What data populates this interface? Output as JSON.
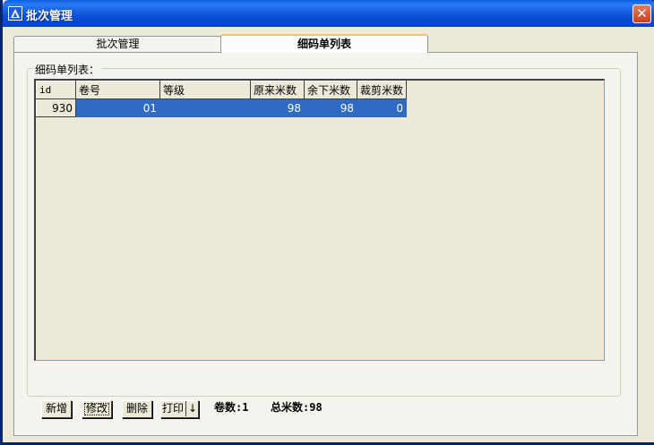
{
  "window": {
    "title": "批次管理",
    "close_glyph": "✕",
    "icon": "app-icon"
  },
  "tabs": [
    {
      "label": "批次管理",
      "active": false
    },
    {
      "label": "细码单列表",
      "active": true
    }
  ],
  "group": {
    "label": "细码单列表："
  },
  "grid": {
    "columns": [
      "id",
      "卷号",
      "等级",
      "原来米数",
      "余下米数",
      "裁剪米数"
    ],
    "rows": [
      {
        "id": "930",
        "roll": "01",
        "grade": "",
        "original": "98",
        "remaining": "98",
        "cut": "0"
      }
    ]
  },
  "toolbar": {
    "add_label": "新增",
    "edit_label": "修改",
    "delete_label": "删除",
    "print_label": "打印",
    "print_arrow": "↓",
    "roll_count": "卷数:1",
    "total_meters": "总米数:98"
  },
  "colors": {
    "titlebar": "#0a5ee0",
    "selection": "#316ac5",
    "background": "#ece9d8"
  }
}
